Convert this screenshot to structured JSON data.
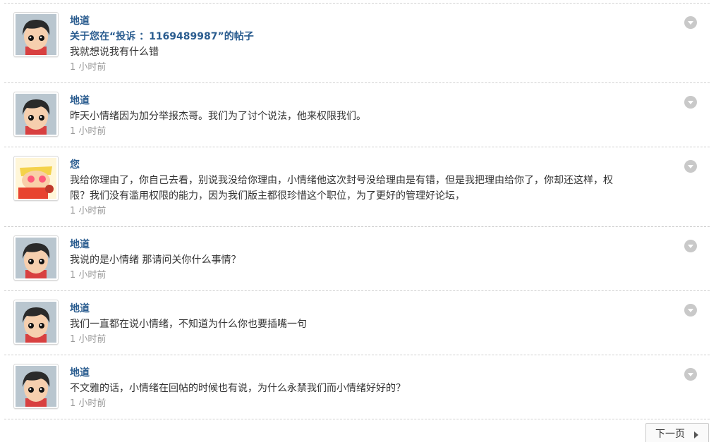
{
  "messages": [
    {
      "avatar": "boy-avatar-icon",
      "name": "地道",
      "subject": "关于您在“投诉 ：1169489987”的帖子",
      "text": "我就想说我有什么错",
      "time": "1 小时前"
    },
    {
      "avatar": "boy-avatar-icon",
      "name": "地道",
      "text": "昨天小情绪因为加分举报杰哥。我们为了讨个说法，他来权限我们。",
      "time": "1 小时前"
    },
    {
      "avatar": "cartoon-avatar-icon",
      "name": "您",
      "text": "我给你理由了，你自己去看，别说我没给你理由，小情绪他这次封号没给理由是有错，但是我把理由给你了，你却还这样，权限？我们没有滥用权限的能力，因为我们版主都很珍惜这个职位，为了更好的管理好论坛，",
      "time": "1 小时前"
    },
    {
      "avatar": "boy-avatar-icon",
      "name": "地道",
      "text": "我说的是小情绪  那请问关你什么事情？",
      "time": "1 小时前"
    },
    {
      "avatar": "boy-avatar-icon",
      "name": "地道",
      "text": "我们一直都在说小情绪，不知道为什么你也要插嘴一句",
      "time": "1 小时前"
    },
    {
      "avatar": "boy-avatar-icon",
      "name": "地道",
      "text": "不文雅的话，小情绪在回帖的时候也有说，为什么永禁我们而小情绪好好的？",
      "time": "1 小时前"
    }
  ],
  "pagination": {
    "next_label": "下一页"
  },
  "colors": {
    "name": "#2a5c8f",
    "time": "#999999",
    "divider": "#cfcfcf"
  }
}
